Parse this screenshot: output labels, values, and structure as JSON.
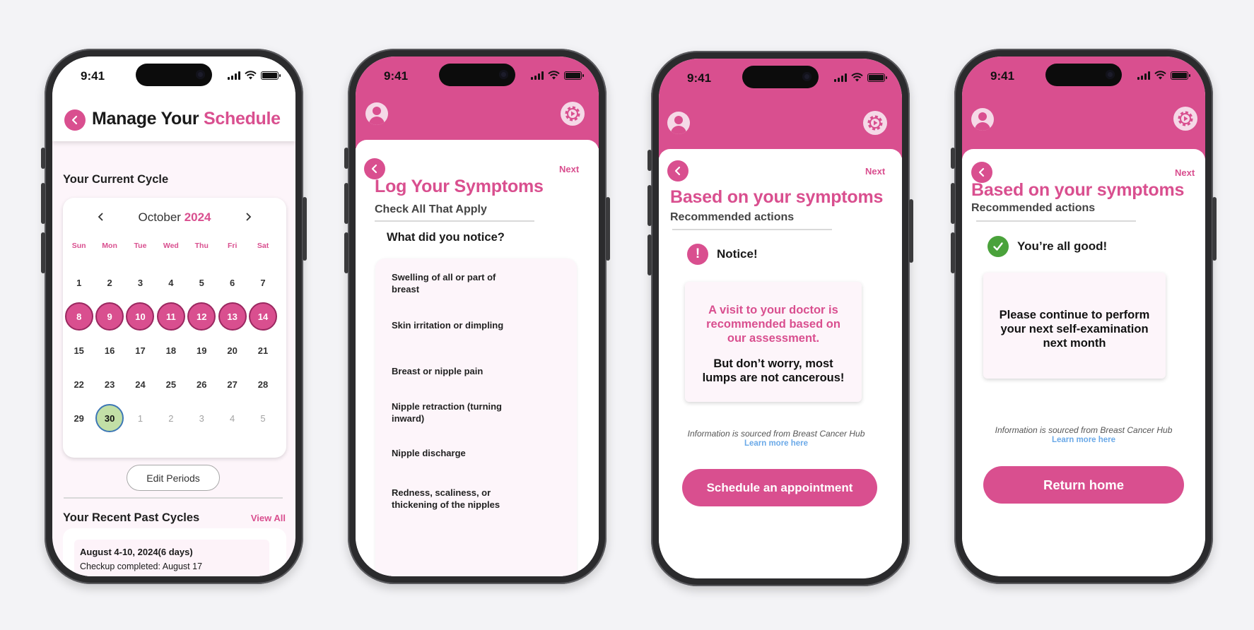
{
  "status": {
    "time": "9:41"
  },
  "colors": {
    "accent": "#d94f8f",
    "period": "#d94f8f",
    "today": "#c2dfa6",
    "good": "#4aa23b",
    "link": "#6aa9e8"
  },
  "screen1": {
    "title_a": "Manage Your",
    "title_b": "Schedule",
    "current_cycle": "Your Current Cycle",
    "month": "October",
    "year": "2024",
    "weekdays": [
      "Sun",
      "Mon",
      "Tue",
      "Wed",
      "Thu",
      "Fri",
      "Sat"
    ],
    "days": [
      {
        "d": "1",
        "s": ""
      },
      {
        "d": "2",
        "s": ""
      },
      {
        "d": "3",
        "s": ""
      },
      {
        "d": "4",
        "s": ""
      },
      {
        "d": "5",
        "s": ""
      },
      {
        "d": "6",
        "s": ""
      },
      {
        "d": "7",
        "s": ""
      },
      {
        "d": "8",
        "s": "period"
      },
      {
        "d": "9",
        "s": "period"
      },
      {
        "d": "10",
        "s": "period"
      },
      {
        "d": "11",
        "s": "period"
      },
      {
        "d": "12",
        "s": "period"
      },
      {
        "d": "13",
        "s": "period"
      },
      {
        "d": "14",
        "s": "period"
      },
      {
        "d": "15",
        "s": ""
      },
      {
        "d": "16",
        "s": ""
      },
      {
        "d": "17",
        "s": ""
      },
      {
        "d": "18",
        "s": ""
      },
      {
        "d": "19",
        "s": ""
      },
      {
        "d": "20",
        "s": ""
      },
      {
        "d": "21",
        "s": ""
      },
      {
        "d": "22",
        "s": ""
      },
      {
        "d": "23",
        "s": ""
      },
      {
        "d": "24",
        "s": ""
      },
      {
        "d": "25",
        "s": ""
      },
      {
        "d": "26",
        "s": ""
      },
      {
        "d": "27",
        "s": ""
      },
      {
        "d": "28",
        "s": ""
      },
      {
        "d": "29",
        "s": ""
      },
      {
        "d": "30",
        "s": "today"
      },
      {
        "d": "1",
        "s": "muted"
      },
      {
        "d": "2",
        "s": "muted"
      },
      {
        "d": "3",
        "s": "muted"
      },
      {
        "d": "4",
        "s": "muted"
      },
      {
        "d": "5",
        "s": "muted"
      }
    ],
    "edit_periods": "Edit Periods",
    "recent_cycles": "Your Recent Past Cycles",
    "view_all": "View All",
    "past_cycle": {
      "dates": "August 4-10, 2024(6 days)",
      "note": "Checkup completed: August 17"
    }
  },
  "screen2": {
    "next": "Next",
    "title": "Log Your Symptoms",
    "subtitle": "Check All That Apply",
    "question": "What did you notice?",
    "symptoms": [
      "Swelling of all or part of breast",
      "Skin irritation or dimpling",
      "Breast or nipple pain",
      "Nipple retraction (turning inward)",
      "Nipple discharge",
      "Redness, scaliness, or thickening of the nipples"
    ]
  },
  "screen3": {
    "next": "Next",
    "title": "Based on your symptoms",
    "subtitle": "Recommended actions",
    "notice": "Notice!",
    "notice_icon": "!",
    "message_pink": "A visit to your doctor is recommended based on our assessment.",
    "message_black": "But don’t worry, most lumps are not cancerous!",
    "source": "Information is sourced from Breast Cancer Hub",
    "learn_more": "Learn more here",
    "cta": "Schedule an appointment"
  },
  "screen4": {
    "next": "Next",
    "title": "Based on your symptoms",
    "subtitle": "Recommended actions",
    "status": "You’re all good!",
    "message": "Please continue to perform your next self-examination next month",
    "source": "Information is sourced from Breast Cancer Hub",
    "learn_more": "Learn more here",
    "cta": "Return home"
  }
}
